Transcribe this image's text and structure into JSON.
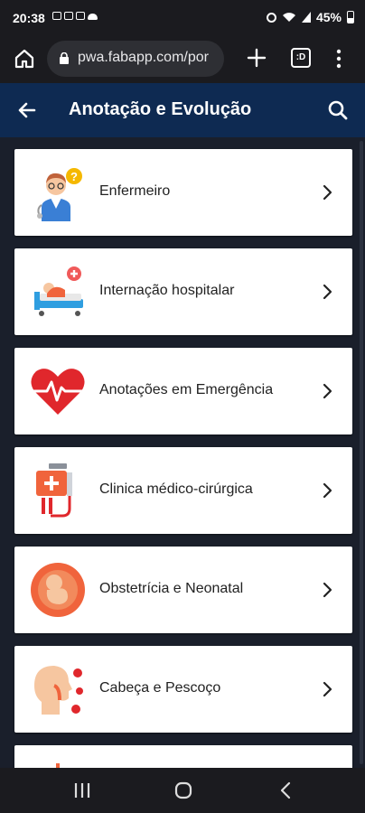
{
  "status_bar": {
    "time": "20:38",
    "battery": "45%"
  },
  "browser": {
    "url": "pwa.fabapp.com/por",
    "tabs_label": ":D"
  },
  "header": {
    "title": "Anotação e Evolução"
  },
  "items": [
    {
      "label": "Enfermeiro",
      "icon": "nurse-icon"
    },
    {
      "label": "Internação hospitalar",
      "icon": "hospital-bed-icon"
    },
    {
      "label": "Anotações em Emergência",
      "icon": "heart-pulse-icon"
    },
    {
      "label": "Clinica médico-cirúrgica",
      "icon": "iv-bag-icon"
    },
    {
      "label": "Obstetrícia e Neonatal",
      "icon": "fetus-icon"
    },
    {
      "label": "Cabeça e Pescoço",
      "icon": "head-neck-icon"
    }
  ],
  "colors": {
    "header_bg": "#0e2a52",
    "content_bg": "#1a1f2b",
    "accent_orange": "#f0643c",
    "accent_red": "#e0272c"
  }
}
